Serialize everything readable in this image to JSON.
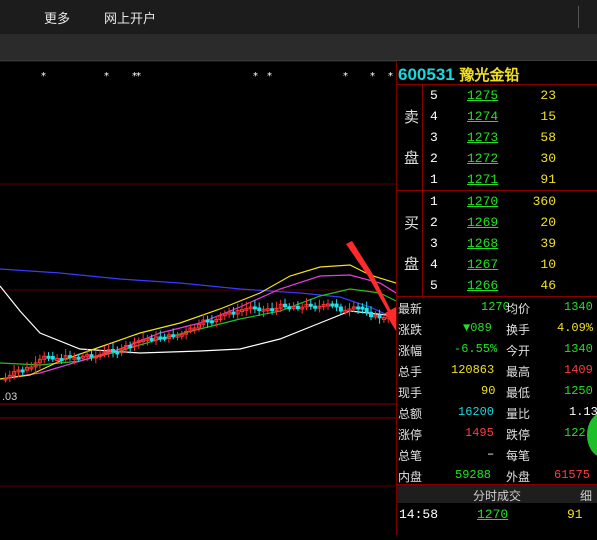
{
  "menu": {
    "items": [
      {
        "label": "更多"
      },
      {
        "label": "网上开户"
      }
    ]
  },
  "chart": {
    "date_label": ".03",
    "colors": {
      "up": "#ff3333",
      "down": "#22e0e8",
      "ma5": "#ffffff",
      "ma10": "#f0e020",
      "ma20": "#e040e0",
      "ma60": "#22c022",
      "long": "#3a3aff"
    }
  },
  "stock": {
    "code": "600531",
    "name": "豫光金铅"
  },
  "order_book": {
    "sell_label": [
      "卖",
      "盘"
    ],
    "buy_label": [
      "买",
      "盘"
    ],
    "sell": [
      {
        "level": "5",
        "price": "1275",
        "volume": "23"
      },
      {
        "level": "4",
        "price": "1274",
        "volume": "15"
      },
      {
        "level": "3",
        "price": "1273",
        "volume": "58"
      },
      {
        "level": "2",
        "price": "1272",
        "volume": "30"
      },
      {
        "level": "1",
        "price": "1271",
        "volume": "91"
      }
    ],
    "buy": [
      {
        "level": "1",
        "price": "1270",
        "volume": "360"
      },
      {
        "level": "2",
        "price": "1269",
        "volume": "20"
      },
      {
        "level": "3",
        "price": "1268",
        "volume": "39"
      },
      {
        "level": "4",
        "price": "1267",
        "volume": "10"
      },
      {
        "level": "5",
        "price": "1266",
        "volume": "46"
      }
    ]
  },
  "quote": {
    "latest_label": "最新",
    "latest": "1270",
    "avg_label": "均价",
    "avg": "1340",
    "change_label": "涨跌",
    "change": "▼089",
    "turnover_label": "换手",
    "turnover": "4.09%",
    "pct_label": "涨幅",
    "pct": "-6.55%",
    "open_label": "今开",
    "open": "1340",
    "vol_label": "总手",
    "vol": "120863",
    "high_label": "最高",
    "high": "1409",
    "cur_label": "现手",
    "cur": "90",
    "low_label": "最低",
    "low": "1250",
    "amount_label": "总额",
    "amount": "16200",
    "ratio_label": "量比",
    "ratio": "1.13",
    "limitup_label": "涨停",
    "limitup": "1495",
    "limitdown_label": "跌停",
    "limitdown": "122",
    "trades_label": "总笔",
    "trades": "–",
    "per_label": "每笔",
    "per": "",
    "inner_label": "内盘",
    "inner": "59288",
    "outer_label": "外盘",
    "outer": "61575"
  },
  "ticks": {
    "header": "分时成交",
    "detail_label": "细",
    "rows": [
      {
        "time": "14:58",
        "price": "1270",
        "volume": "91"
      }
    ]
  }
}
